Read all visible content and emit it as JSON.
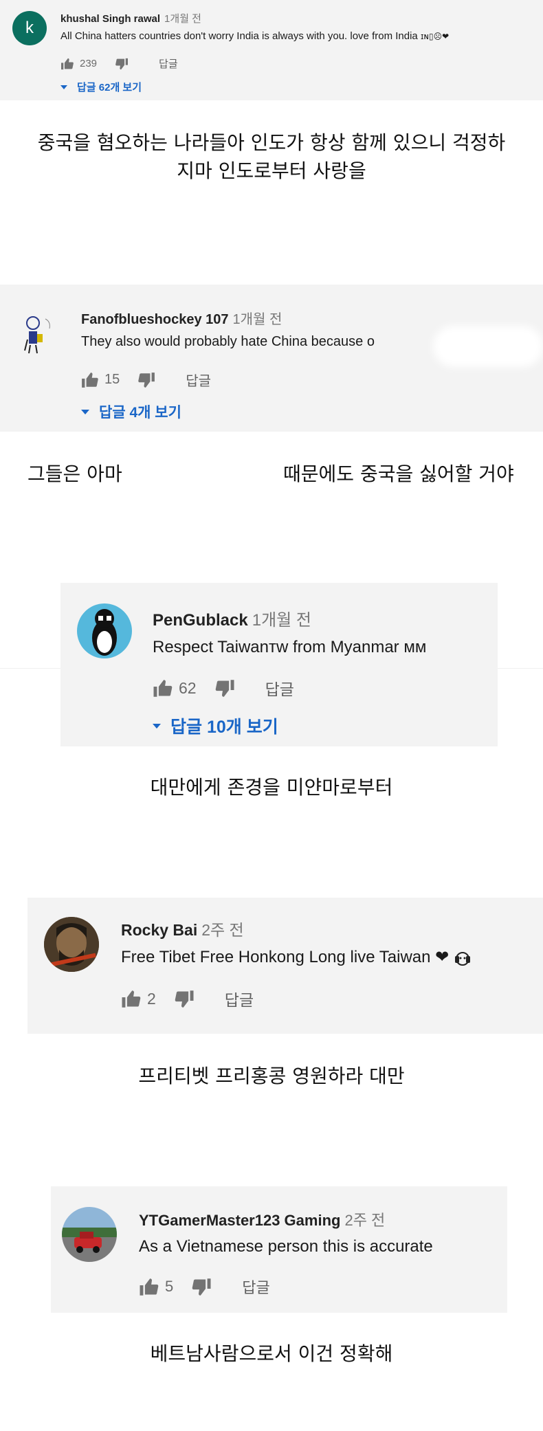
{
  "comments": [
    {
      "author": "khushal Singh rawal",
      "time": "1개월 전",
      "text": "All China hatters countries don't worry India is always with you. love from India",
      "text_tail": "ɪɴ▯☹❤",
      "likes": "239",
      "reply_label": "답글",
      "replies_label": "답글 62개 보기",
      "avatar_letter": "k",
      "translation": [
        "중국을 혐오하는 나라들아 인도가 항상 함께 있으니 걱정하",
        "지마 인도로부터 사랑을"
      ]
    },
    {
      "author": "Fanofblueshockey 107",
      "time": "1개월 전",
      "text": "They also would probably hate China because o",
      "likes": "15",
      "reply_label": "답글",
      "replies_label": "답글 4개 보기",
      "translation_left": "그들은 아마",
      "translation_right": "때문에도 중국을 싫어할 거야"
    },
    {
      "author": "PenGublack",
      "time": "1개월 전",
      "text": "Respect Taiwanᴛᴡ from Myanmar ᴍᴍ",
      "likes": "62",
      "reply_label": "답글",
      "replies_label": "답글 10개 보기",
      "translation": "대만에게 존경을 미얀마로부터"
    },
    {
      "author": "Rocky Bai",
      "time": "2주 전",
      "text": "Free Tibet Free Honkong Long live Taiwan ❤",
      "likes": "2",
      "reply_label": "답글",
      "translation": "프리티벳 프리홍콩 영원하라 대만"
    },
    {
      "author": "YTGamerMaster123 Gaming",
      "time": "2주 전",
      "text": "As a Vietnamese person this is accurate",
      "likes": "5",
      "reply_label": "답글",
      "translation": "베트남사람으로서 이건 정확해"
    }
  ],
  "icons": {
    "like": "thumbs-up-icon",
    "dislike": "thumbs-down-icon",
    "expand": "caret-down-icon"
  },
  "colors": {
    "card_bg": "#f3f3f3",
    "link_blue": "#1a66c7",
    "avatar_k": "#0b6f5f",
    "avatar_penguin_bg": "#55b8dc"
  }
}
